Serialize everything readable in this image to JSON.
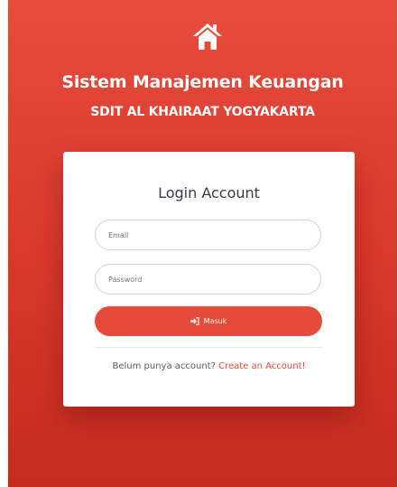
{
  "header": {
    "icon": "home-icon",
    "title": "Sistem Manajemen Keuangan",
    "subtitle": "SDIT AL KHAIRAAT YOGYAKARTA"
  },
  "login": {
    "title": "Login Account",
    "email_placeholder": "Email",
    "password_placeholder": "Password",
    "submit_icon": "sign-in-icon",
    "submit_label": "Masuk",
    "register_prompt": "Belum punya account?",
    "register_link": "Create an Account!"
  },
  "colors": {
    "background": "#e74c3c",
    "accent": "#e74a3b",
    "card": "#ffffff"
  }
}
